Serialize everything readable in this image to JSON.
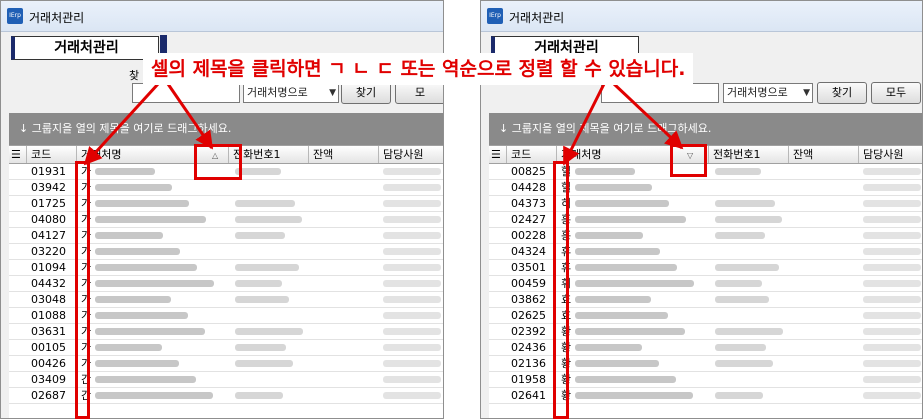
{
  "window": {
    "title": "거래처관리",
    "form_title": "거래처관리",
    "search_label": "찾",
    "combo_value": "거래처명으로",
    "find_button": "찾기",
    "all_button": "모두",
    "all_button_partial": "모"
  },
  "group_band_text": "↓ 그룹지을 열의 제목을 여기로 드래그하세요.",
  "columns": [
    "코드",
    "거래처명",
    "전화번호1",
    "잔액",
    "담당사원"
  ],
  "left_codes": [
    "01931",
    "03942",
    "01725",
    "04080",
    "04127",
    "03220",
    "01094",
    "04432",
    "03048",
    "01088",
    "03631",
    "00105",
    "00426",
    "03409",
    "02687"
  ],
  "left_name_initials": [
    "가",
    "가",
    "가",
    "가",
    "가",
    "가",
    "가",
    "가",
    "가",
    "가",
    "가",
    "가",
    "가",
    "간",
    "간"
  ],
  "right_codes": [
    "00825",
    "04428",
    "04373",
    "02427",
    "00228",
    "04324",
    "03501",
    "00459",
    "03862",
    "02625",
    "02392",
    "02436",
    "02136",
    "01958",
    "02641"
  ],
  "right_name_initials": [
    "힐",
    "힐",
    "히",
    "흥",
    "흥",
    "휴",
    "휴",
    "휘",
    "효",
    "효",
    "황",
    "황",
    "황",
    "황",
    "황"
  ],
  "annotation": {
    "text": "셀의 제목을 클릭하면 ㄱ ㄴ ㄷ 또는 역순으로 정렬 할 수 있습니다.",
    "color": "#e00000"
  },
  "sort": {
    "left": "ascending",
    "right": "descending"
  },
  "icons": {
    "app": "app-logo-icon",
    "grid_menu": "grid-menu-icon",
    "sort_left": "sort-ascending-icon",
    "sort_right": "sort-descending-icon"
  },
  "colors": {
    "highlight": "#e00000",
    "group_band": "#8a8a8a",
    "form_title_accent": "#1b2a6b"
  }
}
